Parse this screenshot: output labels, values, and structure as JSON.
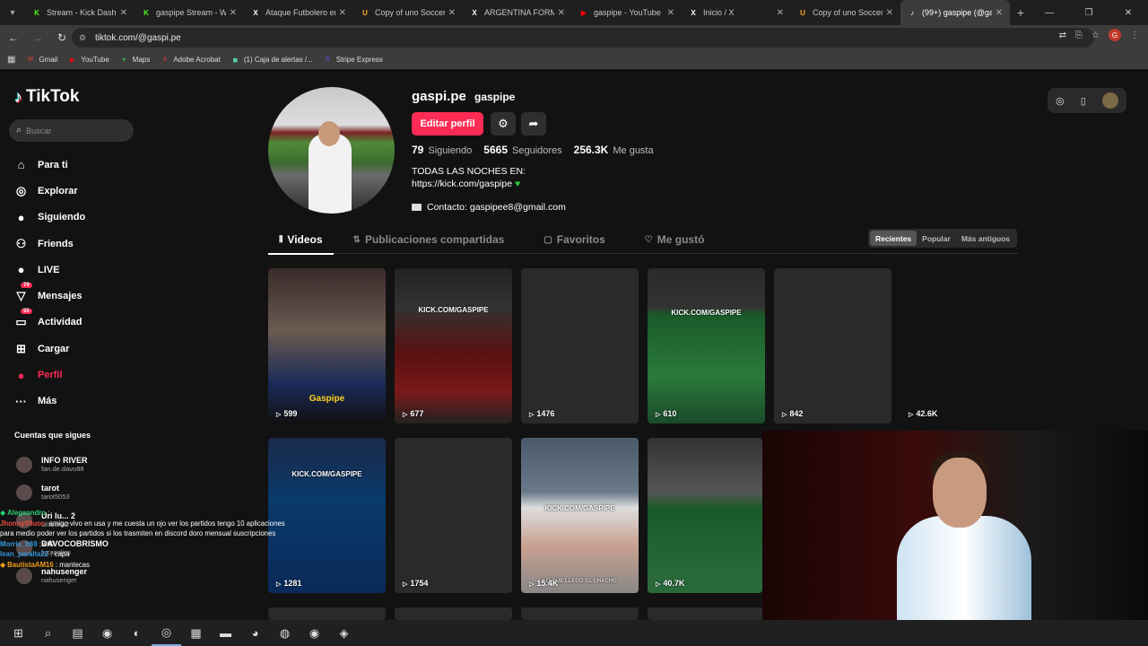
{
  "browser": {
    "tabs": [
      {
        "label": "Stream - Kick Dashbo",
        "icon": "kick-icon",
        "color": "#53fc18",
        "glyph": "K"
      },
      {
        "label": "gaspipe Stream - Wa",
        "icon": "kick-icon",
        "color": "#53fc18",
        "glyph": "K"
      },
      {
        "label": "Ataque Futbolero en",
        "icon": "x-icon",
        "color": "#ffffff",
        "glyph": "X"
      },
      {
        "label": "Copy of uno Soccer S",
        "icon": "u-icon",
        "color": "#f5a623",
        "glyph": "U"
      },
      {
        "label": "ARGENTINA FORMAC",
        "icon": "x-icon",
        "color": "#ffffff",
        "glyph": "X"
      },
      {
        "label": "gaspipe - YouTube",
        "icon": "youtube-icon",
        "color": "#ff0000",
        "glyph": "▶"
      },
      {
        "label": "Inicio / X",
        "icon": "x-icon",
        "color": "#ffffff",
        "glyph": "X"
      },
      {
        "label": "Copy of uno Soccer S",
        "icon": "u-icon",
        "color": "#f5a623",
        "glyph": "U"
      },
      {
        "label": "(99+) gaspipe (@gasp",
        "icon": "tiktok-icon",
        "color": "#ffffff",
        "glyph": "♪",
        "active": true
      }
    ],
    "url": "tiktok.com/@gaspi.pe",
    "bookmarks": [
      {
        "label": "Gmail",
        "icon": "gmail-icon",
        "color": "#ea4335",
        "glyph": "M"
      },
      {
        "label": "YouTube",
        "icon": "youtube-icon",
        "color": "#ff0000",
        "glyph": "▶"
      },
      {
        "label": "Maps",
        "icon": "maps-icon",
        "color": "#34a853",
        "glyph": "●"
      },
      {
        "label": "Adobe Acrobat",
        "icon": "acrobat-icon",
        "color": "#e03a3a",
        "glyph": "A"
      },
      {
        "label": "(1) Caja de alertas /...",
        "icon": "alerts-icon",
        "color": "#5ad0a0",
        "glyph": "◼"
      },
      {
        "label": "Stripe Express",
        "icon": "stripe-icon",
        "color": "#635bff",
        "glyph": "S"
      }
    ],
    "profile_initial": "G"
  },
  "sidebar": {
    "logo": "TikTok",
    "search_placeholder": "Buscar",
    "items": [
      {
        "label": "Para ti",
        "icon": "home-icon",
        "glyph": "⌂"
      },
      {
        "label": "Explorar",
        "icon": "compass-icon",
        "glyph": "◎"
      },
      {
        "label": "Siguiendo",
        "icon": "following-icon",
        "glyph": "●"
      },
      {
        "label": "Friends",
        "icon": "friends-icon",
        "glyph": "⚇"
      },
      {
        "label": "LIVE",
        "icon": "live-icon",
        "glyph": "●"
      },
      {
        "label": "Mensajes",
        "icon": "messages-icon",
        "glyph": "▽",
        "badge": "79"
      },
      {
        "label": "Actividad",
        "icon": "activity-icon",
        "glyph": "▭",
        "badge": "55"
      },
      {
        "label": "Cargar",
        "icon": "upload-icon",
        "glyph": "⊞"
      },
      {
        "label": "Perfil",
        "icon": "profile-icon",
        "glyph": "●",
        "active": true
      },
      {
        "label": "Más",
        "icon": "more-icon",
        "glyph": "···"
      }
    ],
    "following_header": "Cuentas que sigues",
    "following": [
      {
        "name": "INFO RIVER",
        "sub": "fan.de.davo88"
      },
      {
        "name": "tarot",
        "sub": "tarot5053"
      },
      {
        "name": "Uri lu... 2",
        "sub": "urituoria2"
      },
      {
        "name": "DAVOCOBRISMO",
        "sub": "lucasoljes"
      },
      {
        "name": "nahusenger",
        "sub": "nahusenger"
      }
    ]
  },
  "profile": {
    "username": "gaspi.pe",
    "nickname": "gaspipe",
    "edit_label": "Editar perfil",
    "stats": [
      {
        "value": "79",
        "label": "Siguiendo"
      },
      {
        "value": "5665",
        "label": "Seguidores"
      },
      {
        "value": "256.3K",
        "label": "Me gusta"
      }
    ],
    "bio_line1": "TODAS LAS NOCHES EN:",
    "bio_line2": "https://kick.com/gaspipe",
    "contact": "Contacto: gaspipee8@gmail.com"
  },
  "tabs": [
    {
      "label": "Videos",
      "icon": "grid-icon",
      "glyph": "⦀",
      "active": true
    },
    {
      "label": "Publicaciones compartidas",
      "icon": "repost-icon",
      "glyph": "⇅"
    },
    {
      "label": "Favoritos",
      "icon": "bookmark-icon",
      "glyph": "▢"
    },
    {
      "label": "Me gustó",
      "icon": "like-icon",
      "glyph": "♡"
    }
  ],
  "sort": [
    "Recientes",
    "Popular",
    "Más antiguos"
  ],
  "videos": [
    {
      "views": "599",
      "overlay": "Gaspipe"
    },
    {
      "views": "677",
      "overlay": "KICK.COM/GASPIPE"
    },
    {
      "views": "1476"
    },
    {
      "views": "610",
      "overlay": "KICK.COM/GASPIPE"
    },
    {
      "views": "842"
    },
    {
      "views": "42.6K"
    },
    {
      "views": "1281",
      "overlay": "KICK.COM/GASPIPE"
    },
    {
      "views": "1754"
    },
    {
      "views": "15.4K",
      "overlay": "KICK.COM/GASPIPE",
      "caption": "LO QUE LLEGO EL CHACHO"
    },
    {
      "views": "40.7K"
    }
  ],
  "chat": [
    {
      "user": "Alegaandro",
      "text": " :",
      "color": "#2ecc71",
      "prefix": "◆ "
    },
    {
      "user": "Jhonny00uoc",
      "text": ": amigo vivo en usa y me cuesta un ojo ver los partidos tengo 10 aplicaciones para medio poder ver los partidos si los trasmiten en discord doro mensual suscripciones",
      "color": "#e74c3c",
      "prefix": ""
    },
    {
      "user": "Morris_b69",
      "text": " : eh?",
      "color": "#3498db",
      "prefix": ""
    },
    {
      "user": "lean_peralta22",
      "text": " : capa",
      "color": "#3498db",
      "prefix": ""
    },
    {
      "user": "BautistaAM16",
      "text": " : mantecas",
      "color": "#f39c12",
      "prefix": "◆ "
    }
  ],
  "taskbar": [
    {
      "icon": "windows-icon",
      "glyph": "⊞"
    },
    {
      "icon": "search-icon",
      "glyph": "⌕"
    },
    {
      "icon": "taskview-icon",
      "glyph": "▤"
    },
    {
      "icon": "copilot-icon",
      "glyph": "◉"
    },
    {
      "icon": "edge-icon",
      "glyph": "◐"
    },
    {
      "icon": "chrome-icon",
      "glyph": "◎",
      "active": true
    },
    {
      "icon": "store-icon",
      "glyph": "▦"
    },
    {
      "icon": "explorer-icon",
      "glyph": "▬"
    },
    {
      "icon": "firefox-icon",
      "glyph": "◕"
    },
    {
      "icon": "obs-icon",
      "glyph": "◍"
    },
    {
      "icon": "spotify-icon",
      "glyph": "◉"
    },
    {
      "icon": "app-icon",
      "glyph": "◈"
    }
  ]
}
